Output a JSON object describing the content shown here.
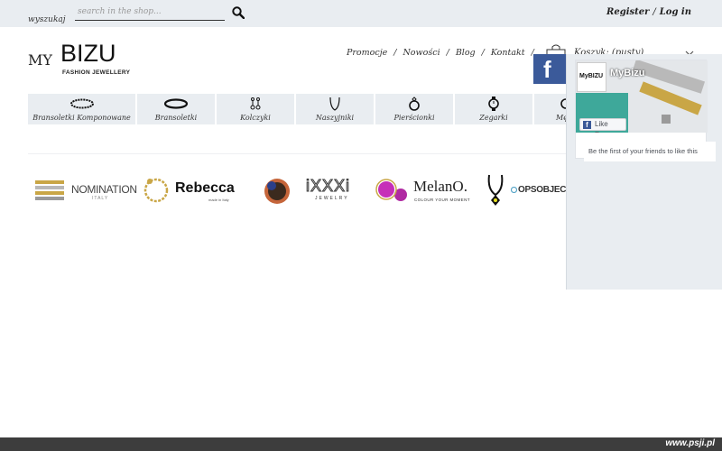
{
  "search": {
    "label": "wyszukaj",
    "placeholder": "search in the shop..."
  },
  "account": {
    "register": "Register",
    "separator": "/",
    "login": "Log in"
  },
  "logo": {
    "my": "MY",
    "brand": "BIZU",
    "tagline": "FASHION JEWELLERY"
  },
  "nav": {
    "items": [
      "Promocje",
      "Nowości",
      "Blog",
      "Kontakt"
    ],
    "separator": "/",
    "cart": "Koszyk: (pusty)"
  },
  "categories": [
    {
      "label": "Bransoletki Komponowane",
      "icon": "composable-bracelet-icon"
    },
    {
      "label": "Bransoletki",
      "icon": "bangle-icon"
    },
    {
      "label": "Kolczyki",
      "icon": "earrings-icon"
    },
    {
      "label": "Naszyjniki",
      "icon": "necklace-icon"
    },
    {
      "label": "Pierścionki",
      "icon": "ring-icon"
    },
    {
      "label": "Zegarki",
      "icon": "watch-icon"
    },
    {
      "label": "Męsk",
      "icon": "mens-icon"
    }
  ],
  "brands": [
    {
      "name": "NOMINATION",
      "sub": "ITALY"
    },
    {
      "name": "Rebecca",
      "sub": "made in Italy"
    },
    {
      "name": "iXXXi",
      "sub": "JEWELRY"
    },
    {
      "name": "MelanO.",
      "sub": "COLOUR YOUR MOMENT"
    },
    {
      "name": "OPSOBJECT",
      "sub": ""
    }
  ],
  "facebook": {
    "tab_letter": "f",
    "page_name": "MyBizu",
    "profile_text": "MyBIZU",
    "like_button": "Like Page",
    "friends_text": "Be the first of your friends to like this"
  },
  "footer": {
    "watermark": "www.psji.pl"
  },
  "colors": {
    "bar_bg": "#e9edf1",
    "fb_blue": "#3b5a9a",
    "footer_bg": "#3d3d3d"
  }
}
